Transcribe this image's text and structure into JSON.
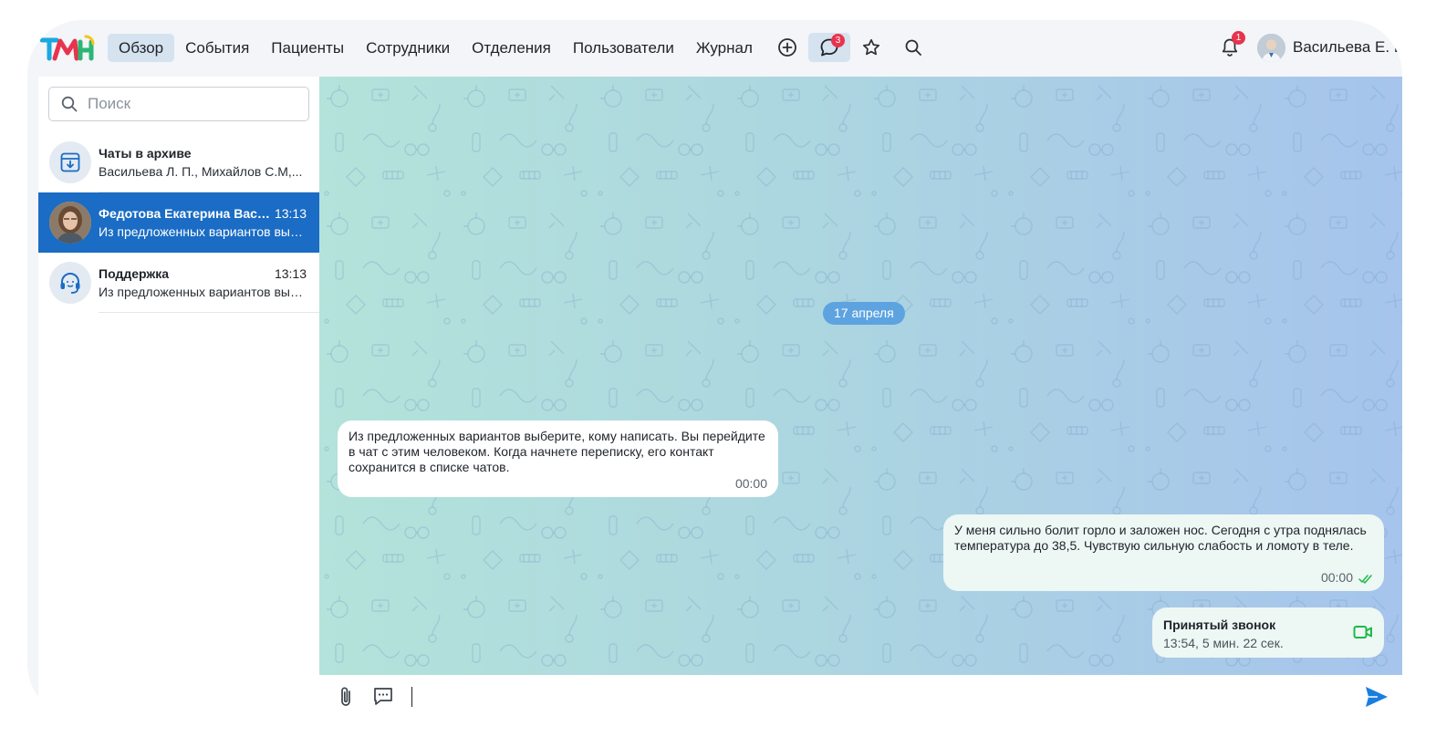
{
  "header": {
    "nav": [
      {
        "label": "Обзор",
        "active": true
      },
      {
        "label": "События",
        "active": false
      },
      {
        "label": "Пациенты",
        "active": false
      },
      {
        "label": "Сотрудники",
        "active": false
      },
      {
        "label": "Отделения",
        "active": false
      },
      {
        "label": "Пользователи",
        "active": false
      },
      {
        "label": "Журнал",
        "active": false
      }
    ],
    "icons": {
      "add": "plus-circle-icon",
      "chat": "chat-bubble-icon",
      "chat_badge": "3",
      "favorites": "star-icon",
      "search": "search-icon"
    },
    "notifications_badge": "1",
    "user_name": "Васильева Е. В."
  },
  "sidebar": {
    "search_placeholder": "Поиск",
    "chats": [
      {
        "name": "Чаты в архиве",
        "time": "",
        "preview": "Васильева Л. П., Михайлов С.М,...",
        "icon": "archive-icon",
        "active": false
      },
      {
        "name": "Федотова Екатерина Васильевна",
        "time": "13:13",
        "preview": "Из предложенных вариантов выберите, кому написать",
        "icon": "user-photo",
        "active": true
      },
      {
        "name": "Поддержка",
        "time": "13:13",
        "preview": "Из предложенных вариантов выберите, кому написать",
        "icon": "headset-icon",
        "active": false
      }
    ]
  },
  "chat": {
    "date_label": "17 апреля",
    "messages": [
      {
        "direction": "in",
        "text": "Из предложенных вариантов выберите, кому написать. Вы перейдите в чат с этим человеком. Когда начнете переписку, его контакт сохранится в списке чатов.",
        "time": "00:00"
      },
      {
        "direction": "out",
        "text": "У меня сильно болит горло и заложен нос. Сегодня с утра поднялась температура до 38,5. Чувствую сильную слабость и ломоту в теле.",
        "time": "00:00",
        "status": "read"
      }
    ],
    "call": {
      "title": "Принятый звонок",
      "details": "13:54, 5 мин. 22 сек.",
      "icon": "video-camera-icon"
    }
  },
  "colors": {
    "accent": "#1a6cc4",
    "nav_active_bg": "#d5e2ef",
    "badge": "#e8344e",
    "call_green": "#1fb84a",
    "send_blue": "#1a7ee0"
  }
}
